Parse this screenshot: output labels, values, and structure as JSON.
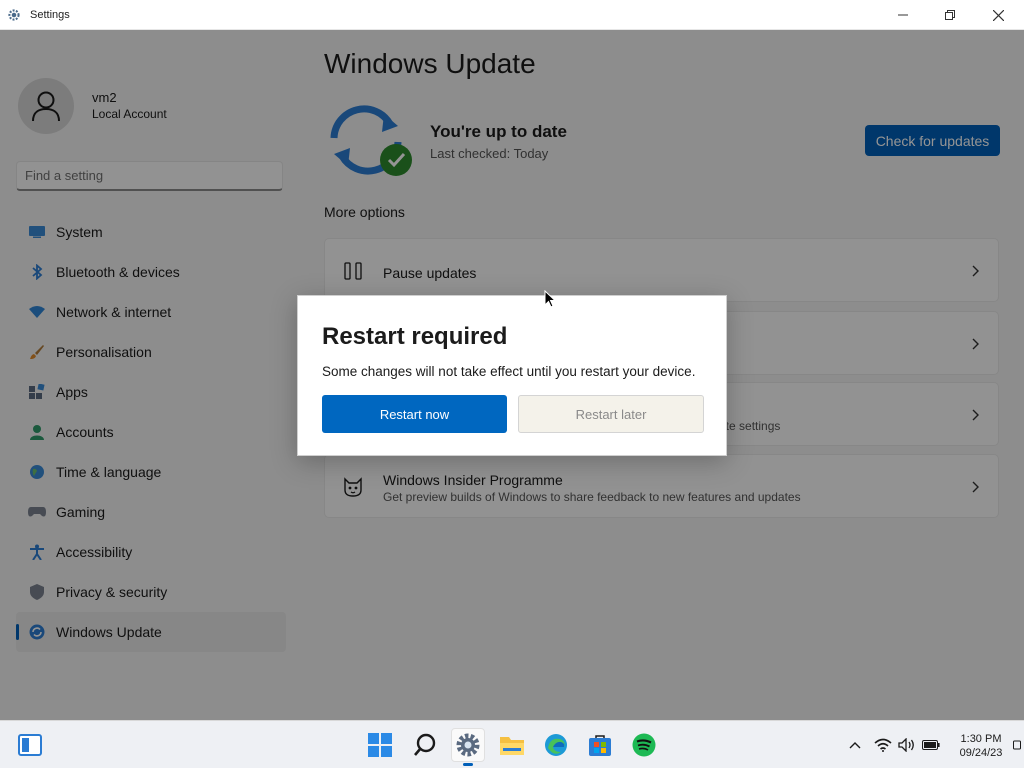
{
  "window": {
    "title": "Settings",
    "controls": [
      "minimize-icon",
      "restore-icon",
      "close-icon"
    ]
  },
  "account": {
    "name": "vm2",
    "type": "Local Account"
  },
  "search": {
    "placeholder": "Find a setting"
  },
  "sidebar": {
    "items": [
      {
        "label": "System",
        "icon": "system-icon"
      },
      {
        "label": "Bluetooth & devices",
        "icon": "bluetooth-icon"
      },
      {
        "label": "Network & internet",
        "icon": "network-icon"
      },
      {
        "label": "Personalisation",
        "icon": "brush-icon"
      },
      {
        "label": "Apps",
        "icon": "apps-icon"
      },
      {
        "label": "Accounts",
        "icon": "accounts-icon"
      },
      {
        "label": "Time & language",
        "icon": "globe-icon"
      },
      {
        "label": "Gaming",
        "icon": "gamepad-icon"
      },
      {
        "label": "Accessibility",
        "icon": "accessibility-icon"
      },
      {
        "label": "Privacy & security",
        "icon": "shield-icon"
      },
      {
        "label": "Windows Update",
        "icon": "update-icon",
        "active": true
      }
    ]
  },
  "main": {
    "title": "Windows Update",
    "status_title": "You're up to date",
    "status_sub": "Last checked: Today",
    "check_button": "Check for updates",
    "more_options": "More options",
    "cards": [
      {
        "title": "Pause updates",
        "subtitle": "",
        "icon": "pause-icon"
      },
      {
        "title": "",
        "subtitle": "",
        "icon": "history-icon"
      },
      {
        "title": "",
        "subtitle": "ate settings",
        "icon": "gear-icon"
      },
      {
        "title": "Windows Insider Programme",
        "subtitle": "Get preview builds of Windows to share feedback to new features and updates",
        "icon": "insider-icon"
      }
    ]
  },
  "dialog": {
    "title": "Restart required",
    "message": "Some changes will not take effect until you restart your device.",
    "primary": "Restart now",
    "secondary": "Restart later"
  },
  "taskbar": {
    "apps": [
      "start-icon",
      "search-icon",
      "settings-icon",
      "file-explorer-icon",
      "edge-icon",
      "store-icon",
      "spotify-icon"
    ],
    "active_app": "settings-icon",
    "time": "1:30 PM",
    "date": "09/24/23"
  },
  "colors": {
    "accent": "#005fb8",
    "dialog_primary": "#0067c0",
    "check_green": "#2e8b2e"
  }
}
